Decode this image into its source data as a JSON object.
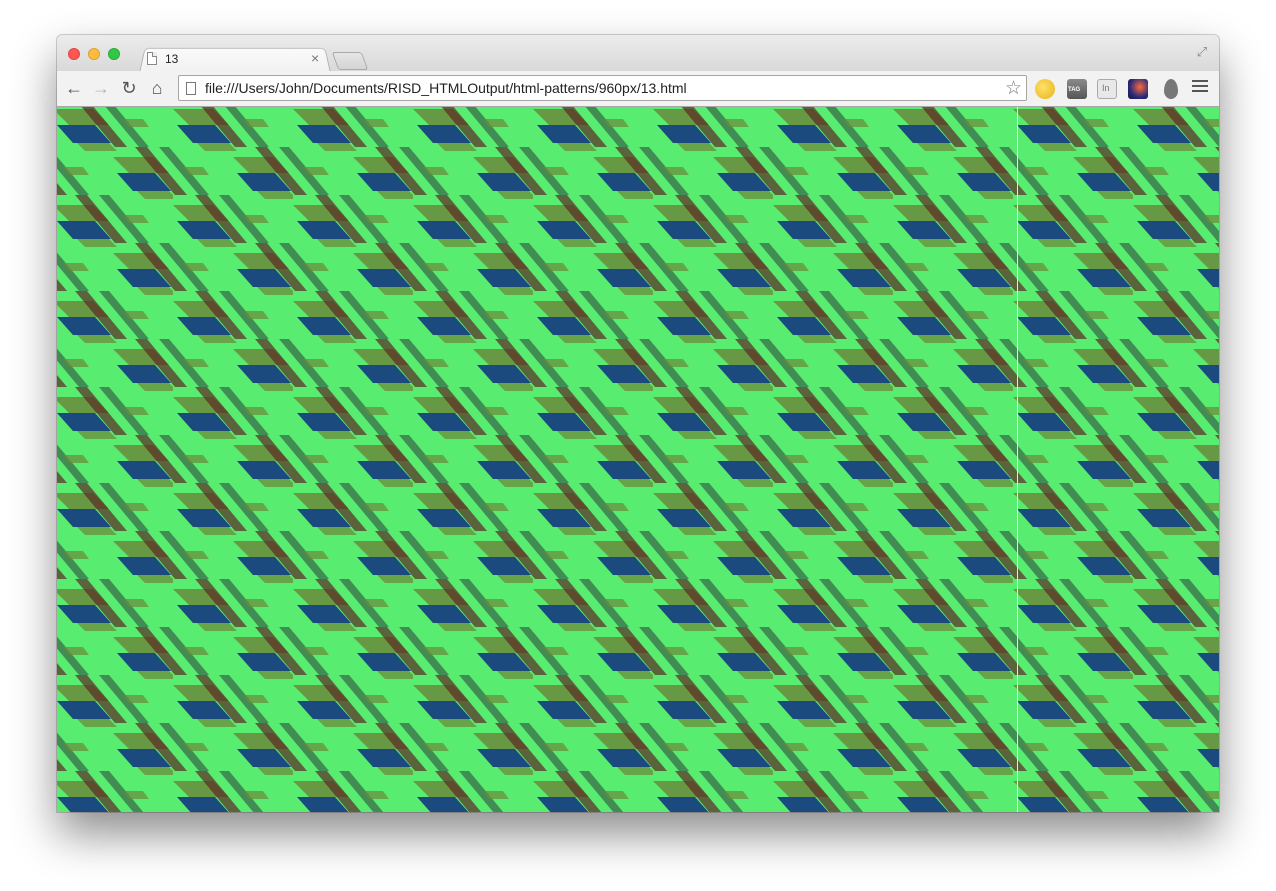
{
  "window": {
    "tab_title": "13",
    "tab_close_glyph": "×"
  },
  "toolbar": {
    "back_glyph": "←",
    "forward_glyph": "→",
    "reload_glyph": "↻",
    "home_glyph": "⌂",
    "url": "file:///Users/John/Documents/RISD_HTMLOutput/html-patterns/960px/13.html",
    "star_glyph": "☆",
    "extensions": [
      "folder-icon",
      "tag-icon",
      "linkedin-icon",
      "speedometer-icon",
      "drop-icon"
    ],
    "ext_tag_label": "TAG",
    "ext_in_label": "In"
  },
  "content": {
    "pattern": {
      "background": "#58ec70",
      "colors": [
        "#1b4b7e",
        "#5b2a25",
        "#6a8a3c",
        "#2d3d3a"
      ]
    }
  }
}
